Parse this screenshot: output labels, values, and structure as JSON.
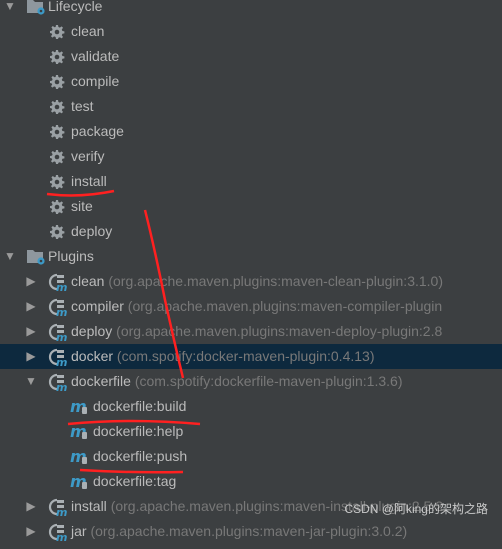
{
  "lifecycle": {
    "label": "Lifecycle",
    "expanded": true,
    "phases": [
      "clean",
      "validate",
      "compile",
      "test",
      "package",
      "verify",
      "install",
      "site",
      "deploy"
    ]
  },
  "plugins": {
    "label": "Plugins",
    "expanded": true,
    "items": [
      {
        "name": "clean",
        "coords": "(org.apache.maven.plugins:maven-clean-plugin:3.1.0)",
        "expanded": false
      },
      {
        "name": "compiler",
        "coords": "(org.apache.maven.plugins:maven-compiler-plugin",
        "expanded": false
      },
      {
        "name": "deploy",
        "coords": "(org.apache.maven.plugins:maven-deploy-plugin:2.8",
        "expanded": false
      },
      {
        "name": "docker",
        "coords": "(com.spotify:docker-maven-plugin:0.4.13)",
        "expanded": false,
        "selected": true
      },
      {
        "name": "dockerfile",
        "coords": "(com.spotify:dockerfile-maven-plugin:1.3.6)",
        "expanded": true,
        "goals": [
          "dockerfile:build",
          "dockerfile:help",
          "dockerfile:push",
          "dockerfile:tag"
        ]
      },
      {
        "name": "install",
        "coords": "(org.apache.maven.plugins:maven-install-plugin:2.5.2",
        "expanded": false
      },
      {
        "name": "jar",
        "coords": "(org.apache.maven.plugins:maven-jar-plugin:3.0.2)",
        "expanded": false
      }
    ]
  },
  "watermark": "CSDN @阿king的架构之路",
  "colors": {
    "background": "#3c3f41",
    "selection": "#0d293e",
    "text": "#bbbbbb",
    "muted": "#787878",
    "annotation": "#ff2020",
    "accent": "#3d9ac7"
  }
}
